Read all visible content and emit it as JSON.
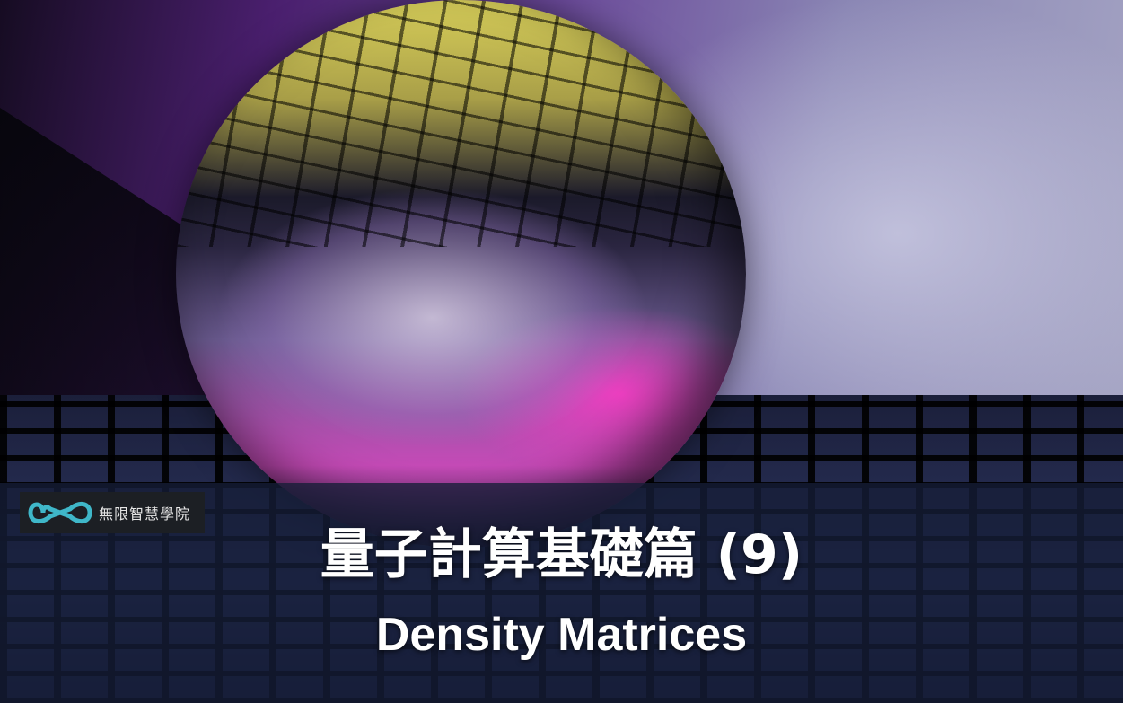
{
  "logo": {
    "text": "無限智慧學院",
    "icon": "infinity-icon",
    "icon_color": "#3fb7c9"
  },
  "title": {
    "chinese": "量子計算基礎篇 (9)",
    "english": "Density Matrices"
  },
  "colors": {
    "banner": "#161e37",
    "title_text": "#ffffff",
    "logo_bg": "#1c1f24"
  },
  "background": {
    "subject": "crystal-ball-on-grid"
  }
}
